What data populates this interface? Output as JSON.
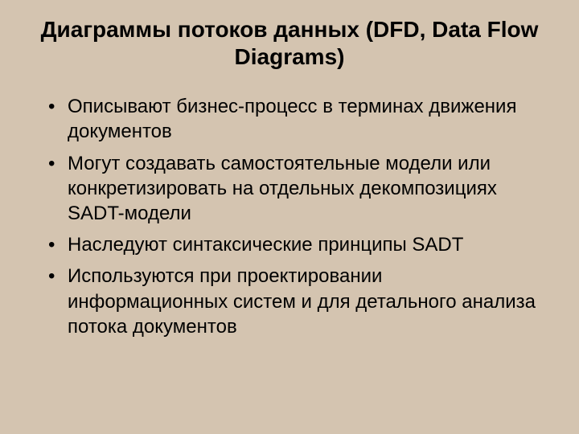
{
  "slide": {
    "title": "Диаграммы потоков данных (DFD, Data Flow Diagrams)",
    "bullets": [
      "Описывают бизнес-процесс в терминах движения документов",
      "Могут создавать самостоятельные модели или конкретизировать на отдельных декомпозициях SADT-модели",
      "Наследуют синтаксические принципы SADT",
      "Используются при проектировании информационных систем и для детального анализа потока документов"
    ]
  }
}
